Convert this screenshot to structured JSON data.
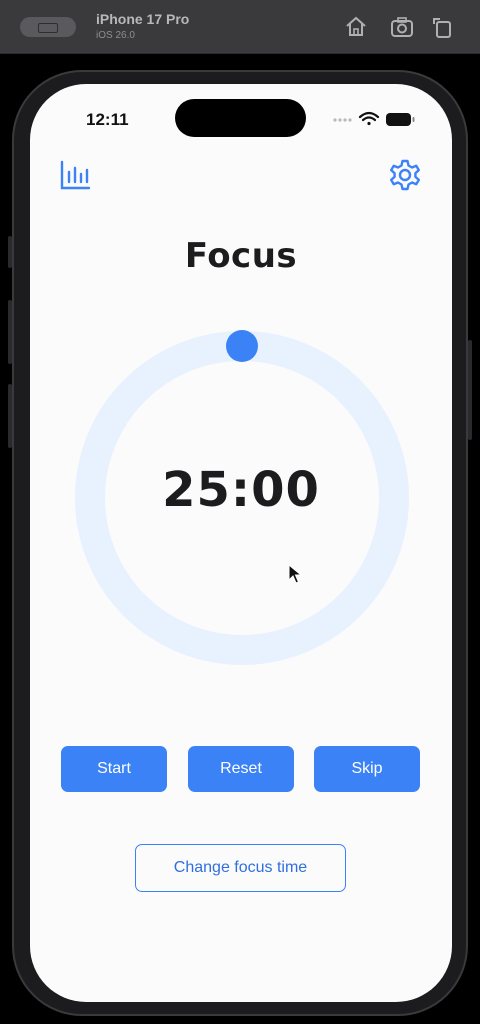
{
  "simulator": {
    "device_name": "iPhone 17 Pro",
    "os_version": "iOS 26.0",
    "toolbar_icons": [
      "home-icon",
      "screenshot-icon",
      "rotate-icon"
    ]
  },
  "status_bar": {
    "time": "12:11",
    "icons": [
      "cellular-icon",
      "wifi-icon",
      "battery-icon"
    ]
  },
  "header": {
    "left_icon": "stats-chart-icon",
    "right_icon": "settings-gear-icon"
  },
  "timer": {
    "mode_title": "Focus",
    "time_display": "25:00",
    "progress_fraction": 0.0
  },
  "controls": {
    "start_label": "Start",
    "reset_label": "Reset",
    "skip_label": "Skip",
    "change_time_label": "Change focus time"
  },
  "colors": {
    "accent": "#3b82f6",
    "ring_track": "#e8f1fe",
    "background": "#fbfbfb",
    "text": "#1c1c1e"
  }
}
